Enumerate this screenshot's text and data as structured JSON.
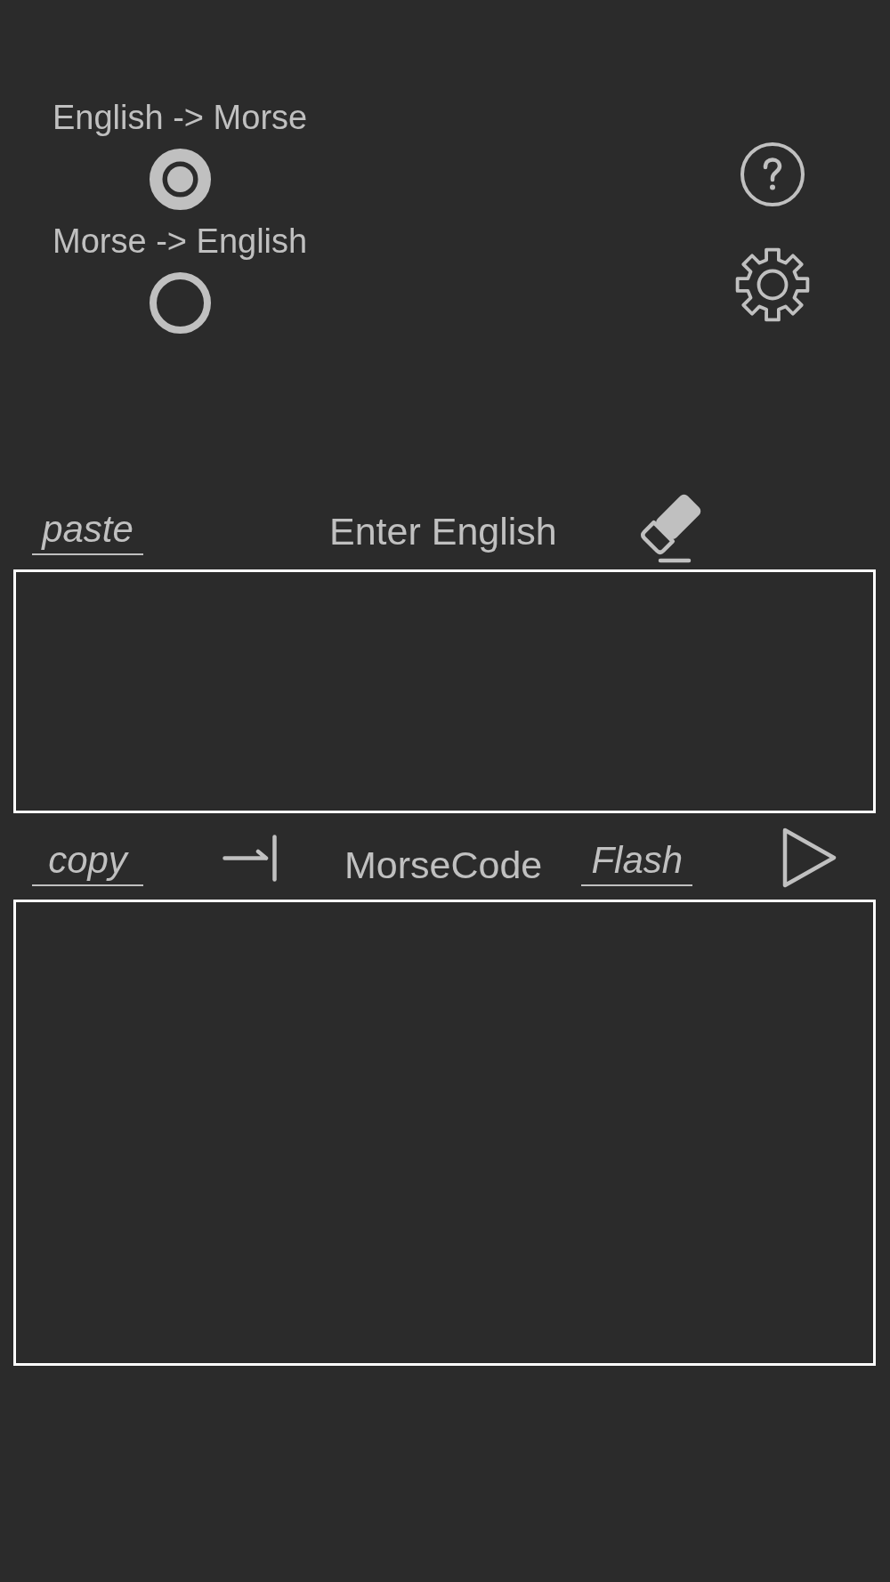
{
  "modes": [
    {
      "label": "English -> Morse",
      "selected": true
    },
    {
      "label": "Morse -> English",
      "selected": false
    }
  ],
  "input_panel": {
    "paste_link": "paste",
    "heading": "Enter English"
  },
  "output_panel": {
    "copy_link": "copy",
    "heading": "MorseCode",
    "flash_link": "Flash"
  }
}
